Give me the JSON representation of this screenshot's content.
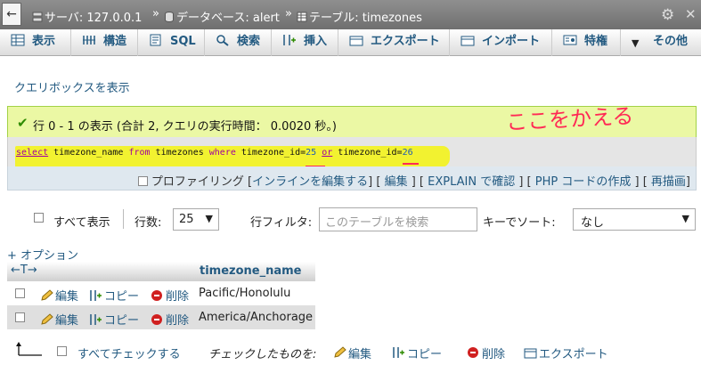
{
  "breadcrumb": {
    "back": "←",
    "server": "サーバ: 127.0.0.1",
    "database": "データベース: alert",
    "table": "テーブル: timezones",
    "sep": "»"
  },
  "tabs": [
    {
      "label": "表示",
      "icon": "browse-icon"
    },
    {
      "label": "構造",
      "icon": "structure-icon"
    },
    {
      "label": "SQL",
      "icon": "sql-icon"
    },
    {
      "label": "検索",
      "icon": "search-icon"
    },
    {
      "label": "挿入",
      "icon": "insert-icon"
    },
    {
      "label": "エクスポート",
      "icon": "export-icon"
    },
    {
      "label": "インポート",
      "icon": "import-icon"
    },
    {
      "label": "特権",
      "icon": "privileges-icon"
    },
    {
      "label": "その他",
      "icon": "chevron-down-icon"
    }
  ],
  "query_box_link": "クエリボックスを表示",
  "success": {
    "message": "行 0 - 1 の表示 (合計 2, クエリの実行時間： 0.0020 秒。)",
    "annotation": "ここをかえる"
  },
  "sql": {
    "kw_select": "select",
    "p1": " timezone_name ",
    "kw_from": "from",
    "p2": " timezones ",
    "kw_where": "where",
    "p3": " timezone_id=",
    "v1": "25",
    "kw_or": "or",
    "p4": " timezone_id=",
    "v2": "26"
  },
  "sql_actions": {
    "profiling": "プロファイリング",
    "inline_edit": "インラインを編集する",
    "edit": "編集",
    "explain": "EXPLAIN で確認",
    "php": "PHP コードの作成",
    "refresh": "再描画"
  },
  "nav": {
    "show_all": "すべて表示",
    "rows_label": "行数:",
    "rows_value": "25",
    "filter_label": "行フィルタ:",
    "filter_placeholder": "このテーブルを検索",
    "sort_label": "キーでソート:",
    "sort_value": "なし"
  },
  "options_link": "+ オプション",
  "table": {
    "arrows": "←T→",
    "column": "timezone_name",
    "edit": "編集",
    "copy": "コピー",
    "delete": "削除",
    "rows": [
      "Pacific/Honolulu",
      "America/Anchorage"
    ]
  },
  "bottom": {
    "check_all": "すべてチェックする",
    "with_selected": "チェックしたものを:",
    "edit": "編集",
    "copy": "コピー",
    "delete": "削除",
    "export": "エクスポート"
  },
  "colors": {
    "link": "#235a81",
    "success_bg": "#ebf8a4",
    "highlight": "#f2f230",
    "annotation": "#ff2a55"
  }
}
